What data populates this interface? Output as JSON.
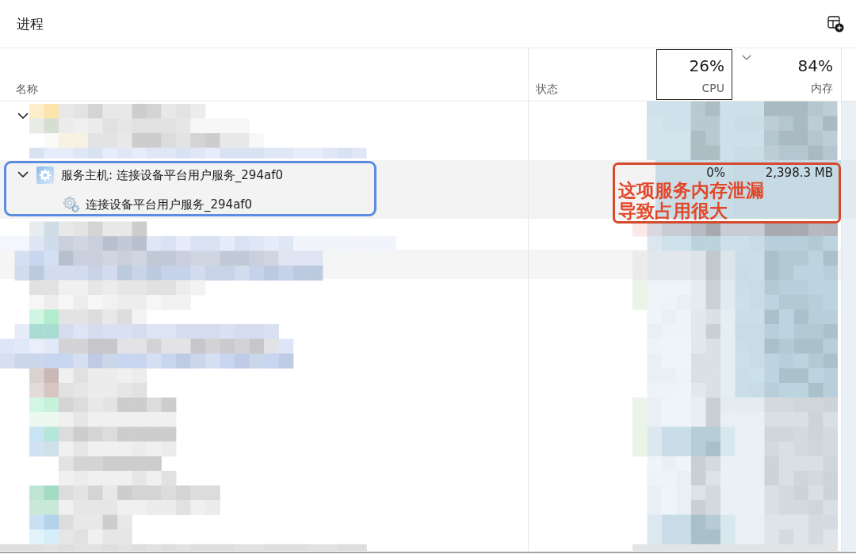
{
  "window": {
    "title": "进程"
  },
  "columns": [
    {
      "label": "名称",
      "focused": false,
      "sorted": false
    },
    {
      "label": "状态",
      "focused": false,
      "sorted": false
    },
    {
      "label": "CPU",
      "total": "26%",
      "focused": true,
      "sorted": false
    },
    {
      "label": "内存",
      "total": "84%",
      "focused": false,
      "sorted": true
    }
  ],
  "pixelated_rows": [
    {
      "expanded": true
    }
  ],
  "rows": [
    {
      "name": "服务主机: 连接设备平台用户服务_294af0",
      "expanded": true,
      "selected": true,
      "cpu": "0%",
      "memory": "2,398.3 MB",
      "children": [
        {
          "name": "连接设备平台用户服务_294af0"
        }
      ]
    }
  ],
  "annotation": {
    "text": "这项服务内存泄漏导致占用很大"
  }
}
